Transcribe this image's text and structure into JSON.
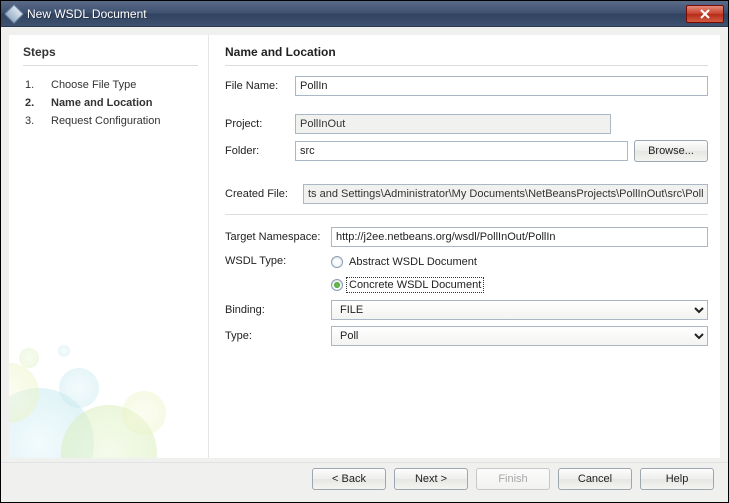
{
  "window": {
    "title": "New WSDL Document"
  },
  "sidebar": {
    "heading": "Steps",
    "items": [
      {
        "num": "1.",
        "label": "Choose File Type"
      },
      {
        "num": "2.",
        "label": "Name and Location"
      },
      {
        "num": "3.",
        "label": "Request Configuration"
      }
    ],
    "current_index": 1
  },
  "content": {
    "heading": "Name and Location",
    "labels": {
      "file_name": "File Name:",
      "project": "Project:",
      "folder": "Folder:",
      "created_file": "Created File:",
      "target_namespace": "Target Namespace:",
      "wsdl_type": "WSDL Type:",
      "binding": "Binding:",
      "type": "Type:"
    },
    "values": {
      "file_name": "PollIn",
      "project": "PollInOut",
      "folder": "src",
      "created_file": "ts and Settings\\Administrator\\My Documents\\NetBeansProjects\\PollInOut\\src\\PollIn.wsdl",
      "target_namespace": "http://j2ee.netbeans.org/wsdl/PollInOut/PollIn",
      "wsdl_type_options": {
        "abstract": "Abstract WSDL Document",
        "concrete": "Concrete WSDL Document"
      },
      "wsdl_type_selected": "concrete",
      "binding": "FILE",
      "type": "Poll"
    },
    "buttons": {
      "browse": "Browse..."
    }
  },
  "footer": {
    "back": "< Back",
    "next": "Next >",
    "finish": "Finish",
    "cancel": "Cancel",
    "help": "Help"
  }
}
